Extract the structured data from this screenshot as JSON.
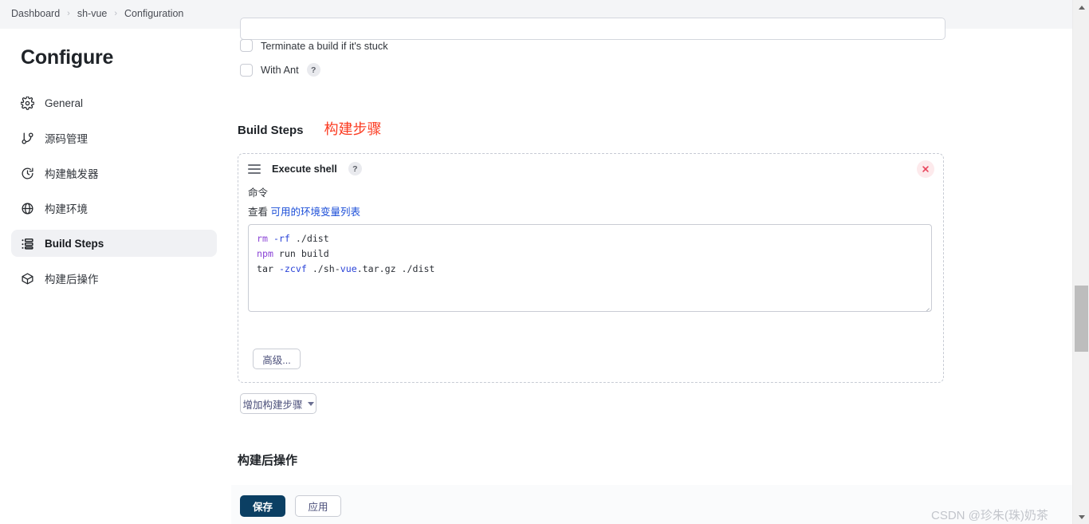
{
  "breadcrumb": {
    "items": [
      "Dashboard",
      "sh-vue",
      "Configuration"
    ],
    "separator": "›"
  },
  "sidebar": {
    "title": "Configure",
    "items": [
      {
        "label": "General",
        "icon": "gear-icon",
        "active": false
      },
      {
        "label": "源码管理",
        "icon": "git-branch-icon",
        "active": false
      },
      {
        "label": "构建触发器",
        "icon": "clock-icon",
        "active": false
      },
      {
        "label": "构建环境",
        "icon": "globe-icon",
        "active": false
      },
      {
        "label": "Build Steps",
        "icon": "list-icon",
        "active": true
      },
      {
        "label": "构建后操作",
        "icon": "package-icon",
        "active": false
      }
    ]
  },
  "checkboxes": [
    {
      "label": "Terminate a build if it's stuck",
      "checked": false,
      "help": false
    },
    {
      "label": "With Ant",
      "checked": false,
      "help": true
    }
  ],
  "build_steps": {
    "heading_en": "Build Steps",
    "heading_zh_annotation": "构建步骤",
    "annotation_color": "#fb3b21",
    "step": {
      "title": "Execute shell",
      "help_label": "?",
      "field_label": "命令",
      "env_prefix": "查看",
      "env_link": "可用的环境变量列表",
      "env_link_color": "#1b4ed8",
      "command": "rm -rf ./dist\nnpm run build\ntar -zcvf ./sh-vue.tar.gz ./dist",
      "command_lines": [
        {
          "tokens": [
            {
              "t": "rm",
              "k": "cmd"
            },
            {
              "t": " ",
              "k": "plain"
            },
            {
              "t": "-rf",
              "k": "flag"
            },
            {
              "t": " ./dist",
              "k": "plain"
            }
          ]
        },
        {
          "tokens": [
            {
              "t": "npm",
              "k": "cmd"
            },
            {
              "t": " run build",
              "k": "plain"
            }
          ]
        },
        {
          "tokens": [
            {
              "t": "tar",
              "k": "plain"
            },
            {
              "t": " ",
              "k": "plain"
            },
            {
              "t": "-zcvf",
              "k": "flag"
            },
            {
              "t": " ./sh-",
              "k": "plain"
            },
            {
              "t": "vue",
              "k": "flag"
            },
            {
              "t": ".tar.gz ./dist",
              "k": "plain"
            }
          ]
        }
      ],
      "advanced_button": "高级...",
      "remove_button": "close-icon"
    },
    "add_step_button": "增加构建步骤"
  },
  "post_build": {
    "heading": "构建后操作"
  },
  "footer": {
    "save_label": "保存",
    "apply_label": "应用",
    "save_color": "#0b3f63"
  },
  "watermark": {
    "text": "CSDN @珍朱(珠)奶茶"
  },
  "scrollbar": {
    "position_percent": 56
  }
}
